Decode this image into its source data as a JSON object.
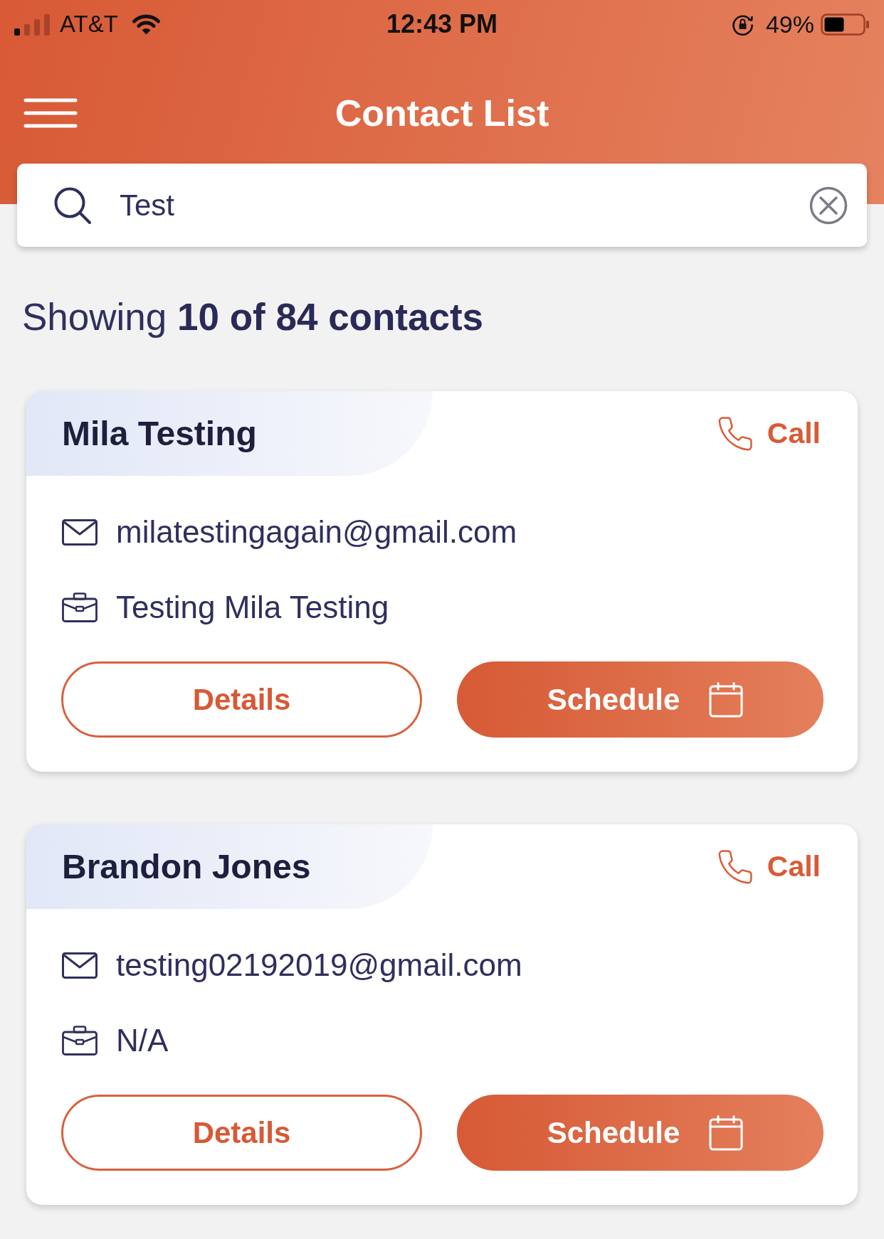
{
  "status_bar": {
    "carrier": "AT&T",
    "time": "12:43 PM",
    "battery": "49%"
  },
  "header": {
    "title": "Contact List"
  },
  "search": {
    "value": "Test"
  },
  "summary": "Showing **10 of 84 contacts**",
  "contacts": [
    {
      "name": "Mila Testing",
      "call": "Call",
      "email": "milatestingagain@gmail.com",
      "company": "Testing Mila Testing",
      "details": "Details",
      "schedule": "Schedule"
    },
    {
      "name": "Brandon Jones",
      "call": "Call",
      "email": "testing02192019@gmail.com",
      "company": "N/A",
      "details": "Details",
      "schedule": "Schedule"
    }
  ]
}
